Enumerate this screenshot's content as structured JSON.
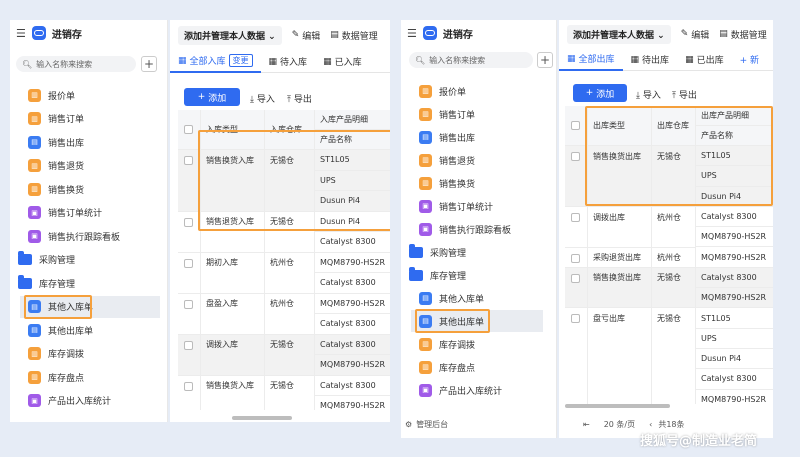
{
  "app_title": "进销存",
  "left": {
    "search_placeholder": "输入名称来搜索",
    "menu": [
      {
        "label": "报价单",
        "icon": "orange"
      },
      {
        "label": "销售订单",
        "icon": "orange"
      },
      {
        "label": "销售出库",
        "icon": "blue"
      },
      {
        "label": "销售退货",
        "icon": "orange"
      },
      {
        "label": "销售换货",
        "icon": "orange"
      },
      {
        "label": "销售订单统计",
        "icon": "purple"
      },
      {
        "label": "销售执行跟踪看板",
        "icon": "purple"
      }
    ],
    "folders": [
      "采购管理",
      "库存管理"
    ],
    "sub_menu": [
      {
        "label": "其他入库单",
        "icon": "blue"
      },
      {
        "label": "其他出库单",
        "icon": "blue"
      },
      {
        "label": "库存调拨",
        "icon": "orange"
      },
      {
        "label": "库存盘点",
        "icon": "orange"
      },
      {
        "label": "产品出入库统计",
        "icon": "purple"
      }
    ],
    "view_name": "添加并管理本人数据",
    "edit": "编辑",
    "data_mgmt": "数据管理",
    "tabs": [
      "全部入库",
      "待入库",
      "已入库"
    ],
    "tab_badge": "变更",
    "add": "添加",
    "import": "导入",
    "export": "导出",
    "columns": [
      "入库类型",
      "入库仓库",
      "入库产品明细",
      "产品名称"
    ],
    "rows": [
      {
        "type": "销售换货入库",
        "wh": "无锡仓",
        "items": [
          "ST1L05",
          "UPS",
          "Dusun Pi4"
        ]
      },
      {
        "type": "销售退货入库",
        "wh": "无锡仓",
        "items": [
          "Dusun Pi4",
          "Catalyst 8300"
        ]
      },
      {
        "type": "期初入库",
        "wh": "杭州仓",
        "items": [
          "MQM8790-HS2R",
          "Catalyst 8300"
        ]
      },
      {
        "type": "盘盈入库",
        "wh": "杭州仓",
        "items": [
          "MQM8790-HS2R",
          "Catalyst 8300"
        ]
      },
      {
        "type": "调拨入库",
        "wh": "无锡仓",
        "items": [
          "Catalyst 8300",
          "MQM8790-HS2R"
        ]
      },
      {
        "type": "销售换货入库",
        "wh": "无锡仓",
        "items": [
          "Catalyst 8300",
          "MQM8790-HS2R"
        ]
      }
    ]
  },
  "right": {
    "search_placeholder": "输入名称来搜索",
    "menu": [
      {
        "label": "报价单",
        "icon": "orange"
      },
      {
        "label": "销售订单",
        "icon": "orange"
      },
      {
        "label": "销售出库",
        "icon": "blue"
      },
      {
        "label": "销售退货",
        "icon": "orange"
      },
      {
        "label": "销售换货",
        "icon": "orange"
      },
      {
        "label": "销售订单统计",
        "icon": "purple"
      },
      {
        "label": "销售执行跟踪看板",
        "icon": "purple"
      }
    ],
    "folders": [
      "采购管理",
      "库存管理"
    ],
    "sub_menu": [
      {
        "label": "其他入库单",
        "icon": "blue"
      },
      {
        "label": "其他出库单",
        "icon": "blue"
      },
      {
        "label": "库存调拨",
        "icon": "orange"
      },
      {
        "label": "库存盘点",
        "icon": "orange"
      },
      {
        "label": "产品出入库统计",
        "icon": "purple"
      }
    ],
    "admin": "管理后台",
    "view_name": "添加并管理本人数据",
    "edit": "编辑",
    "data_mgmt": "数据管理",
    "tabs": [
      "全部出库",
      "待出库",
      "已出库"
    ],
    "tab_more": "+ 新",
    "add": "添加",
    "import": "导入",
    "export": "导出",
    "columns": [
      "出库类型",
      "出库仓库",
      "出库产品明细",
      "产品名称"
    ],
    "rows": [
      {
        "type": "销售换货出库",
        "wh": "无锡仓",
        "items": [
          "ST1L05",
          "UPS",
          "Dusun Pi4"
        ]
      },
      {
        "type": "调拨出库",
        "wh": "杭州仓",
        "items": [
          "Catalyst 8300",
          "MQM8790-HS2R"
        ]
      },
      {
        "type": "采购退货出库",
        "wh": "杭州仓",
        "items": [
          "MQM8790-HS2R"
        ]
      },
      {
        "type": "销售换货出库",
        "wh": "无锡仓",
        "items": [
          "Catalyst 8300",
          "MQM8790-HS2R"
        ]
      },
      {
        "type": "盘亏出库",
        "wh": "无锡仓",
        "items": [
          "ST1L05",
          "UPS",
          "Dusun Pi4",
          "Catalyst 8300",
          "MQM8790-HS2R"
        ]
      }
    ],
    "footer": {
      "page_size": "20 条/页",
      "total": "共18条"
    }
  },
  "watermark": "搜狐号@制造业老简",
  "colors": {
    "accent": "#2f6bf0",
    "highlight": "#f5a03c"
  }
}
